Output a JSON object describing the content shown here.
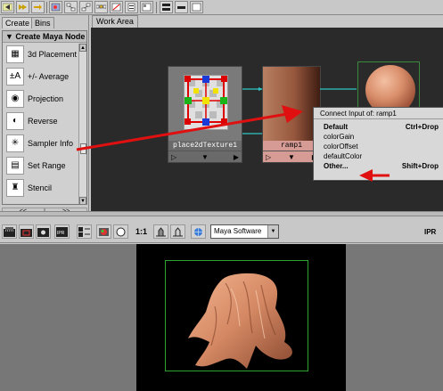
{
  "top_toolbar": {
    "buttons": [
      {
        "name": "scroll-left-icon"
      },
      {
        "name": "scroll-right-icon"
      },
      {
        "name": "map-icon"
      },
      {
        "name": "graph-up-icon"
      },
      {
        "name": "graph-down-icon"
      },
      {
        "name": "graph-both-icon"
      },
      {
        "name": "clear-graph-icon"
      },
      {
        "name": "hide-node-icon"
      },
      {
        "name": "swatch-icon"
      },
      {
        "name": "layout-icon"
      },
      {
        "name": "window-icon"
      },
      {
        "name": "panel-icon"
      },
      {
        "name": "single-view-icon"
      },
      {
        "name": "split-view-icon"
      }
    ]
  },
  "left_panel": {
    "tabs": [
      "Create",
      "Bins"
    ],
    "list_header": "▼ Create Maya Node",
    "items": [
      {
        "label": "3d Placement",
        "icon": "3d-placement-icon",
        "glyph": "▦"
      },
      {
        "label": "+/- Average",
        "icon": "plus-minus-average-icon",
        "glyph": "±A"
      },
      {
        "label": "Projection",
        "icon": "projection-icon",
        "glyph": "◉"
      },
      {
        "label": "Reverse",
        "icon": "reverse-icon",
        "glyph": "◐"
      },
      {
        "label": "Sampler Info",
        "icon": "sampler-info-icon",
        "glyph": "✳"
      },
      {
        "label": "Set Range",
        "icon": "set-range-icon",
        "glyph": "▤"
      },
      {
        "label": "Stencil",
        "icon": "stencil-icon",
        "glyph": "♜"
      }
    ],
    "pager": [
      "<<",
      ">>"
    ]
  },
  "work_area": {
    "tab_label": "Work Area",
    "place2d_label": "place2dTexture1",
    "ramp_label": "ramp1",
    "context_menu": {
      "title": "Connect Input of: ramp1",
      "items": [
        {
          "label": "Default",
          "shortcut": "Ctrl+Drop",
          "bold": true
        },
        {
          "label": "colorGain",
          "shortcut": "",
          "bold": false
        },
        {
          "label": "colorOffset",
          "shortcut": "",
          "bold": false
        },
        {
          "label": "defaultColor",
          "shortcut": "",
          "bold": false
        },
        {
          "label": "Other...",
          "shortcut": "Shift+Drop",
          "bold": true
        }
      ]
    }
  },
  "render_toolbar": {
    "ratio": "1:1",
    "renderer": "Maya Software",
    "ipr": "IPR"
  },
  "colors": {
    "annotation_arrow": "#e01010",
    "connection_line": "#2ec7c7",
    "render_gate": "#2ea32e",
    "ramp_node": "#c47a73"
  }
}
